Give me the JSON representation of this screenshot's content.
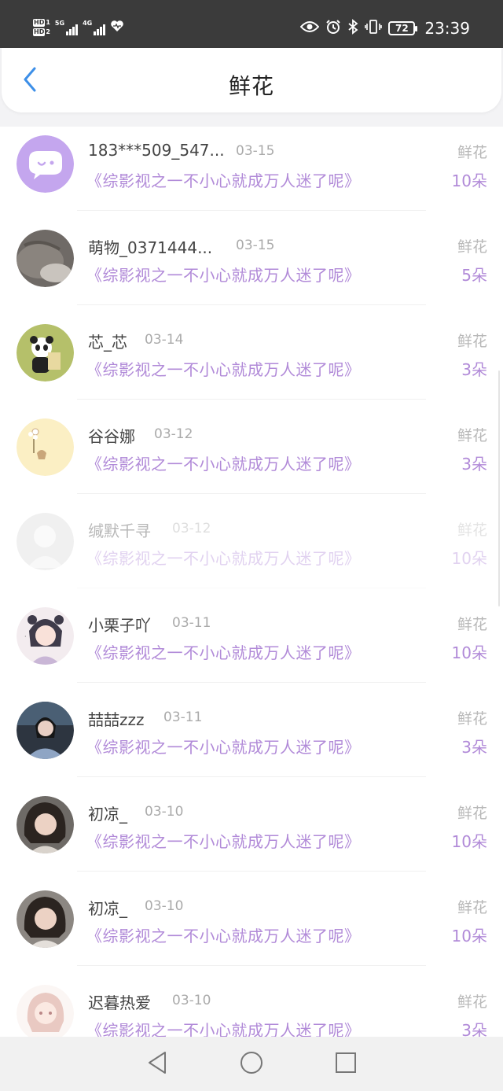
{
  "status_bar": {
    "hd1": "HD",
    "hd1_sub": "1",
    "hd2": "HD",
    "hd2_sub": "2",
    "net1": "5G",
    "net2": "4G",
    "battery": "72",
    "time": "23:39"
  },
  "header": {
    "title": "鲜花"
  },
  "rows": [
    {
      "name": "183***509_547...",
      "date": "03-15",
      "book": "《综影视之一不小心就成万人迷了呢》",
      "type": "鲜花",
      "count": "10朵"
    },
    {
      "name": "萌物_0371444...",
      "date": "03-15",
      "book": "《综影视之一不小心就成万人迷了呢》",
      "type": "鲜花",
      "count": "5朵"
    },
    {
      "name": "芯_芯",
      "date": "03-14",
      "book": "《综影视之一不小心就成万人迷了呢》",
      "type": "鲜花",
      "count": "3朵"
    },
    {
      "name": "谷谷娜",
      "date": "03-12",
      "book": "《综影视之一不小心就成万人迷了呢》",
      "type": "鲜花",
      "count": "3朵"
    },
    {
      "name": "缄默千寻",
      "date": "03-12",
      "book": "《综影视之一不小心就成万人迷了呢》",
      "type": "鲜花",
      "count": "10朵"
    },
    {
      "name": "小栗子吖",
      "date": "03-11",
      "book": "《综影视之一不小心就成万人迷了呢》",
      "type": "鲜花",
      "count": "10朵"
    },
    {
      "name": "喆喆zzz",
      "date": "03-11",
      "book": "《综影视之一不小心就成万人迷了呢》",
      "type": "鲜花",
      "count": "3朵"
    },
    {
      "name": "初凉_",
      "date": "03-10",
      "book": "《综影视之一不小心就成万人迷了呢》",
      "type": "鲜花",
      "count": "10朵"
    },
    {
      "name": "初凉_",
      "date": "03-10",
      "book": "《综影视之一不小心就成万人迷了呢》",
      "type": "鲜花",
      "count": "10朵"
    },
    {
      "name": "迟暮热爱",
      "date": "03-10",
      "book": "《综影视之一不小心就成万人迷了呢》",
      "type": "鲜花",
      "count": "3朵"
    }
  ],
  "colors": {
    "accent": "#b18ad8",
    "status_bar_bg": "#3b3b3b",
    "back_arrow": "#3d8fe8"
  },
  "icons": {
    "back": "back-arrow-icon",
    "eye": "eye-icon",
    "alarm": "alarm-icon",
    "bluetooth": "bluetooth-icon",
    "vibrate": "vibrate-icon",
    "heart": "heart-icon",
    "nav_back": "triangle-back-icon",
    "nav_home": "circle-home-icon",
    "nav_recent": "square-recent-icon"
  }
}
